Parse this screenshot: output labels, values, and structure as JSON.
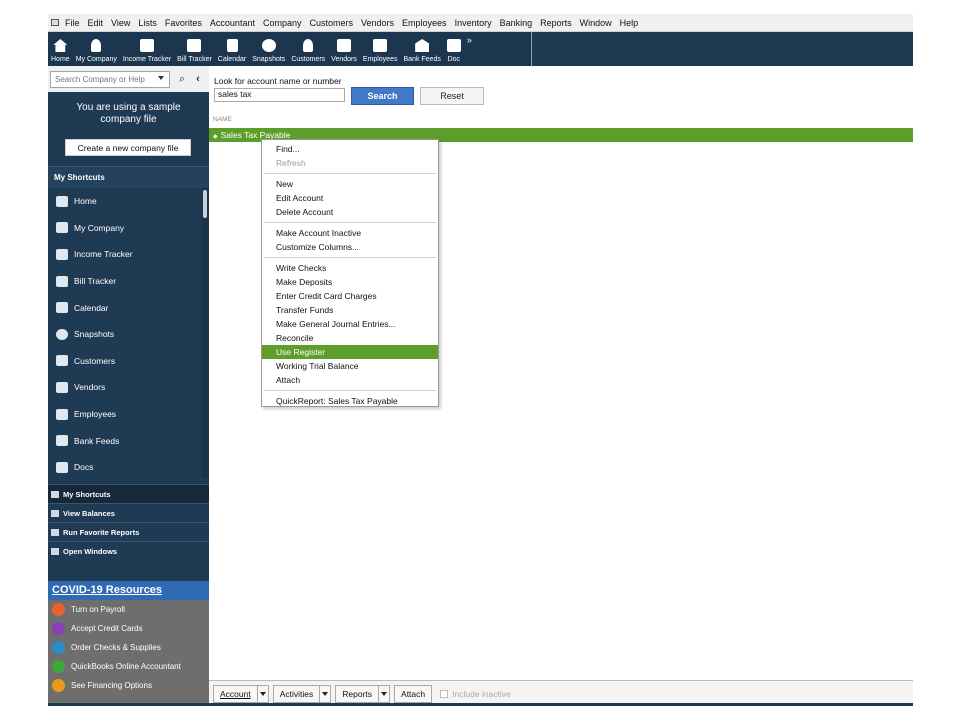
{
  "menubar": {
    "items": [
      "File",
      "Edit",
      "View",
      "Lists",
      "Favorites",
      "Accountant",
      "Company",
      "Customers",
      "Vendors",
      "Employees",
      "Inventory",
      "Banking",
      "Reports",
      "Window",
      "Help"
    ]
  },
  "iconbar": {
    "items": [
      {
        "label": "Home",
        "icon": "home-icon"
      },
      {
        "label": "My Company",
        "icon": "my-company-icon"
      },
      {
        "label": "Income Tracker",
        "icon": "income-tracker-icon"
      },
      {
        "label": "Bill Tracker",
        "icon": "bill-tracker-icon"
      },
      {
        "label": "Calendar",
        "icon": "calendar-icon"
      },
      {
        "label": "Snapshots",
        "icon": "snapshots-icon"
      },
      {
        "label": "Customers",
        "icon": "customers-icon"
      },
      {
        "label": "Vendors",
        "icon": "vendors-icon"
      },
      {
        "label": "Employees",
        "icon": "employees-icon"
      },
      {
        "label": "Bank Feeds",
        "icon": "bank-feeds-icon"
      },
      {
        "label": "Doc",
        "icon": "docs-icon"
      }
    ],
    "more": "»"
  },
  "sidebar": {
    "search_placeholder": "Search Company or Help",
    "sample_text": "You are using a sample company file",
    "create_button": "Create a new company file",
    "shortcuts_header": "My Shortcuts",
    "shortcuts": [
      {
        "label": "Home",
        "icon": "home-icon"
      },
      {
        "label": "My Company",
        "icon": "my-company-icon"
      },
      {
        "label": "Income Tracker",
        "icon": "income-tracker-icon"
      },
      {
        "label": "Bill Tracker",
        "icon": "bill-tracker-icon"
      },
      {
        "label": "Calendar",
        "icon": "calendar-icon"
      },
      {
        "label": "Snapshots",
        "icon": "snapshots-icon"
      },
      {
        "label": "Customers",
        "icon": "customers-icon"
      },
      {
        "label": "Vendors",
        "icon": "vendors-icon"
      },
      {
        "label": "Employees",
        "icon": "employees-icon"
      },
      {
        "label": "Bank Feeds",
        "icon": "bank-feeds-icon"
      },
      {
        "label": "Docs",
        "icon": "docs-icon"
      }
    ],
    "sections": [
      "My Shortcuts",
      "View Balances",
      "Run Favorite Reports",
      "Open Windows"
    ],
    "covid": {
      "title": "COVID-19 Resources",
      "items": [
        {
          "label": "Turn on Payroll",
          "color": "#e8622a"
        },
        {
          "label": "Accept Credit Cards",
          "color": "#8a3fb8"
        },
        {
          "label": "Order Checks & Supplies",
          "color": "#2a8cc8"
        },
        {
          "label": "QuickBooks Online Accountant",
          "color": "#3aa83a"
        },
        {
          "label": "See Financing Options",
          "color": "#e89a1a"
        }
      ]
    }
  },
  "main": {
    "look_label": "Look for account name or number",
    "search_value": "sales tax",
    "search_button": "Search",
    "reset_button": "Reset",
    "column_header": "NAME",
    "selected_row": "Sales Tax Payable"
  },
  "context_menu": {
    "groups": [
      [
        {
          "label": "Find...",
          "disabled": false
        },
        {
          "label": "Refresh",
          "disabled": true
        }
      ],
      [
        {
          "label": "New"
        },
        {
          "label": "Edit Account"
        },
        {
          "label": "Delete Account"
        }
      ],
      [
        {
          "label": "Make Account Inactive"
        },
        {
          "label": "Customize Columns..."
        }
      ],
      [
        {
          "label": "Write Checks"
        },
        {
          "label": "Make Deposits"
        },
        {
          "label": "Enter Credit Card Charges"
        },
        {
          "label": "Transfer Funds"
        },
        {
          "label": "Make General Journal Entries..."
        },
        {
          "label": "Reconcile"
        },
        {
          "label": "Use Register",
          "highlighted": true
        },
        {
          "label": "Working Trial Balance"
        },
        {
          "label": "Attach"
        }
      ],
      [
        {
          "label": "QuickReport: Sales Tax Payable"
        }
      ]
    ]
  },
  "bottombar": {
    "account": "Account",
    "activities": "Activities",
    "reports": "Reports",
    "attach": "Attach",
    "include_inactive": "Include inactive"
  },
  "colors": {
    "navy": "#1f3a53",
    "highlight_green": "#5d9e2a",
    "search_blue": "#3f79c8"
  }
}
